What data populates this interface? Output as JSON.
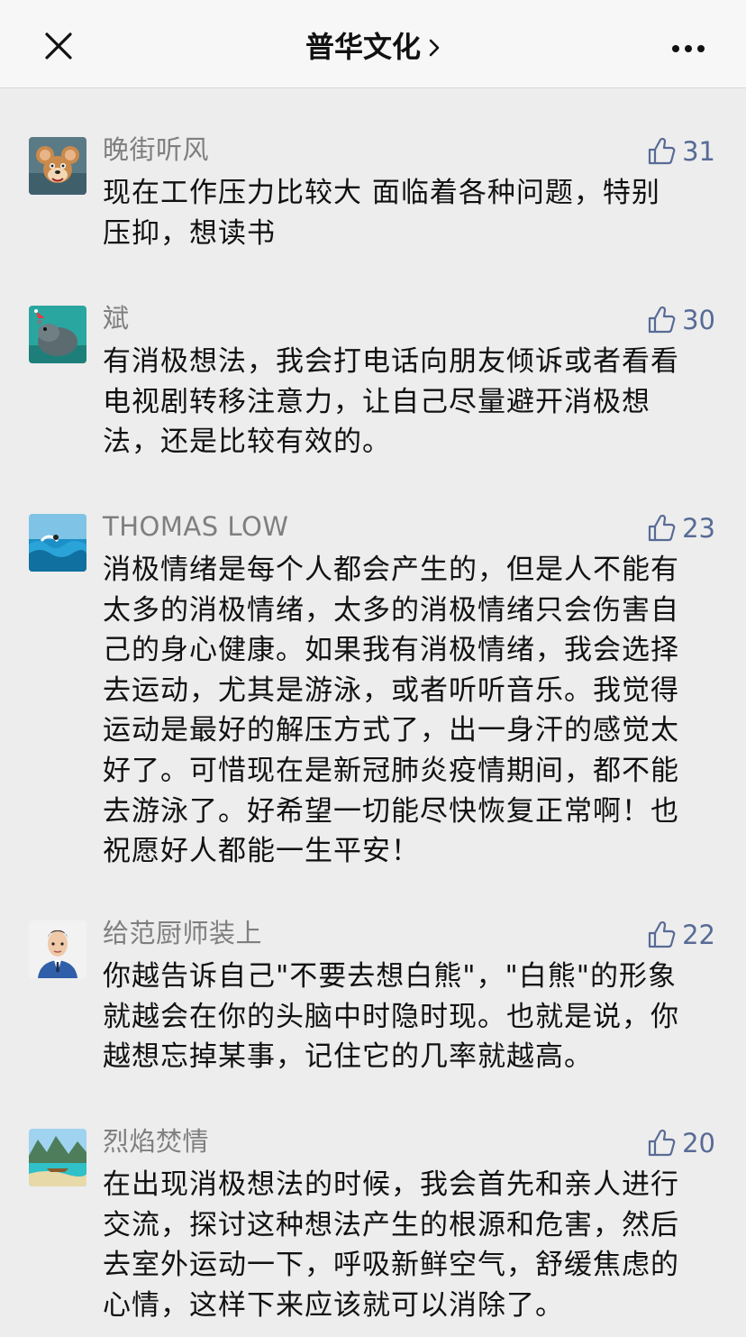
{
  "header": {
    "title": "普华文化",
    "close_icon": "close-icon",
    "chevron_icon": "chevron-right-icon",
    "more_icon": "more-horizontal-icon"
  },
  "colors": {
    "link_blue": "#576b95",
    "username_gray": "#7f7f7f",
    "background": "#ededed"
  },
  "comments": [
    {
      "username": "晚街听风",
      "likes": "31",
      "text": "现在工作压力比较大 面临着各种问题，特别\n压抑，想读书"
    },
    {
      "username": "斌",
      "likes": "30",
      "text": "有消极想法，我会打电话向朋友倾诉或者看看\n电视剧转移注意力，让自己尽量避开消极想\n法，还是比较有效的。"
    },
    {
      "username": "THOMAS LOW",
      "likes": "23",
      "text": "消极情绪是每个人都会产生的，但是人不能有\n太多的消极情绪，太多的消极情绪只会伤害自\n己的身心健康。如果我有消极情绪，我会选择\n去运动，尤其是游泳，或者听听音乐。我觉得\n运动是最好的解压方式了，出一身汗的感觉太\n好了。可惜现在是新冠肺炎疫情期间，都不能\n去游泳了。好希望一切能尽快恢复正常啊！也\n祝愿好人都能一生平安！"
    },
    {
      "username": "给范厨师装上",
      "likes": "22",
      "text": "你越告诉自己\"不要去想白熊\"，\"白熊\"的形象\n就越会在你的头脑中时隐时现。也就是说，你\n越想忘掉某事，记住它的几率就越高。"
    },
    {
      "username": "烈焰焚情",
      "likes": "20",
      "text": "在出现消极想法的时候，我会首先和亲人进行\n交流，探讨这种想法产生的根源和危害，然后\n去室外运动一下，呼吸新鲜空气，舒缓焦虑的\n心情，这样下来应该就可以消除了。"
    }
  ]
}
